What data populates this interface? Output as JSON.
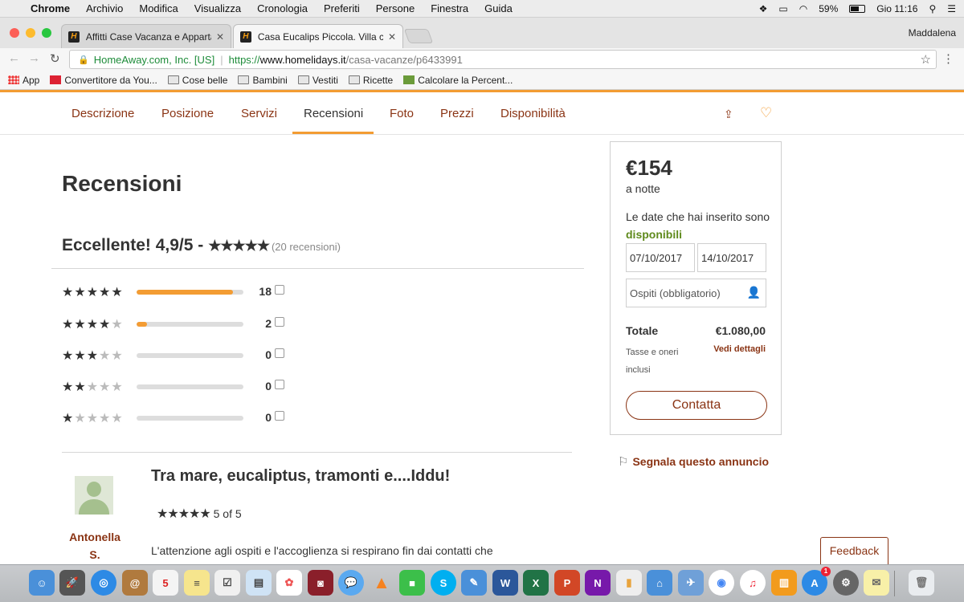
{
  "menubar": {
    "app": "Chrome",
    "items": [
      "Archivio",
      "Modifica",
      "Visualizza",
      "Cronologia",
      "Preferiti",
      "Persone",
      "Finestra",
      "Guida"
    ],
    "battery": "59%",
    "clock": "Gio 11:16"
  },
  "browser": {
    "tabs": [
      {
        "title": "Affitti Case Vacanza e Apparta",
        "favicon": "H"
      },
      {
        "title": "Casa Eucalips Piccola. Villa co",
        "favicon": "H"
      }
    ],
    "profile": "Maddalena",
    "url": {
      "owner": "HomeAway.com, Inc. [US]",
      "scheme": "https://",
      "domain": "www.homelidays.it",
      "path": "/casa-vacanze/p6433991"
    },
    "bookmarks": [
      {
        "label": "App",
        "icon": "apps-icon"
      },
      {
        "label": "Convertitore da You...",
        "icon": "youtube-icon"
      },
      {
        "label": "Cose belle",
        "icon": "folder-icon"
      },
      {
        "label": "Bambini",
        "icon": "folder-icon"
      },
      {
        "label": "Vestiti",
        "icon": "folder-icon"
      },
      {
        "label": "Ricette",
        "icon": "folder-icon"
      },
      {
        "label": "Calcolare la Percent...",
        "icon": "calculator-icon"
      }
    ]
  },
  "pagenav": {
    "items": [
      "Descrizione",
      "Posizione",
      "Servizi",
      "Recensioni",
      "Foto",
      "Prezzi",
      "Disponibilità"
    ],
    "active": "Recensioni"
  },
  "reviews": {
    "heading": "Recensioni",
    "summary_label": "Eccellente! 4,9/5 -",
    "summary_stars": "★★★★★",
    "summary_count": "(20 recensioni)",
    "breakdown": [
      {
        "stars": 5,
        "count": "18",
        "fraction": 0.9
      },
      {
        "stars": 4,
        "count": "2",
        "fraction": 0.1
      },
      {
        "stars": 3,
        "count": "0",
        "fraction": 0
      },
      {
        "stars": 2,
        "count": "0",
        "fraction": 0
      },
      {
        "stars": 1,
        "count": "0",
        "fraction": 0
      }
    ],
    "first": {
      "author_first": "Antonella",
      "author_last": "S.",
      "title": "Tra mare, eucaliptus, tramonti e....Iddu!",
      "stars": "★★★★★",
      "rating_text": "5 of 5",
      "text": "L'attenzione agli ospiti e l'accoglienza si respirano fin dai contatti che"
    }
  },
  "booking": {
    "price": "€154",
    "per": "a notte",
    "avail_prefix": "Le date che hai inserito sono",
    "avail_word": "disponibili",
    "checkin": "07/10/2017",
    "checkout": "14/10/2017",
    "guests_placeholder": "Ospiti (obbligatorio)",
    "total_label": "Totale",
    "total_value": "€1.080,00",
    "tax_note": "Tasse e oneri inclusi",
    "details_link": "Vedi dettagli",
    "contact_button": "Contatta"
  },
  "report_link": "Segnala questo annuncio",
  "feedback_button": "Feedback",
  "calendar_day": "5",
  "appstore_badge": "1",
  "colors": {
    "accent": "#f39c33",
    "brand": "#8a3414",
    "available": "#5f8a1c"
  }
}
